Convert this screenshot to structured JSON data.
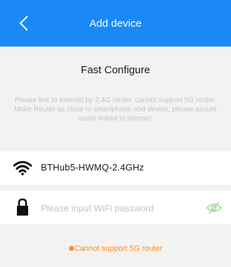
{
  "header": {
    "title": "Add device",
    "back_icon": "chevron-left-icon",
    "background_color": "#1a88f5"
  },
  "section": {
    "title": "Fast Configure",
    "hint": "Please link to internet by 2.4G router, cannot support 5G router. Make Router as close to smartphone and device; please assure router linked to internet."
  },
  "wifi": {
    "icon": "wifi-icon",
    "ssid": "BTHub5-HWMQ-2.4GHz"
  },
  "password": {
    "icon": "lock-icon",
    "value": "",
    "placeholder": "Please input WiFi password",
    "toggle_icon": "eye-off-icon",
    "toggle_color": "#a8dca0"
  },
  "warning": {
    "text": "Cannot support 5G router",
    "color": "#ff8c1a"
  }
}
